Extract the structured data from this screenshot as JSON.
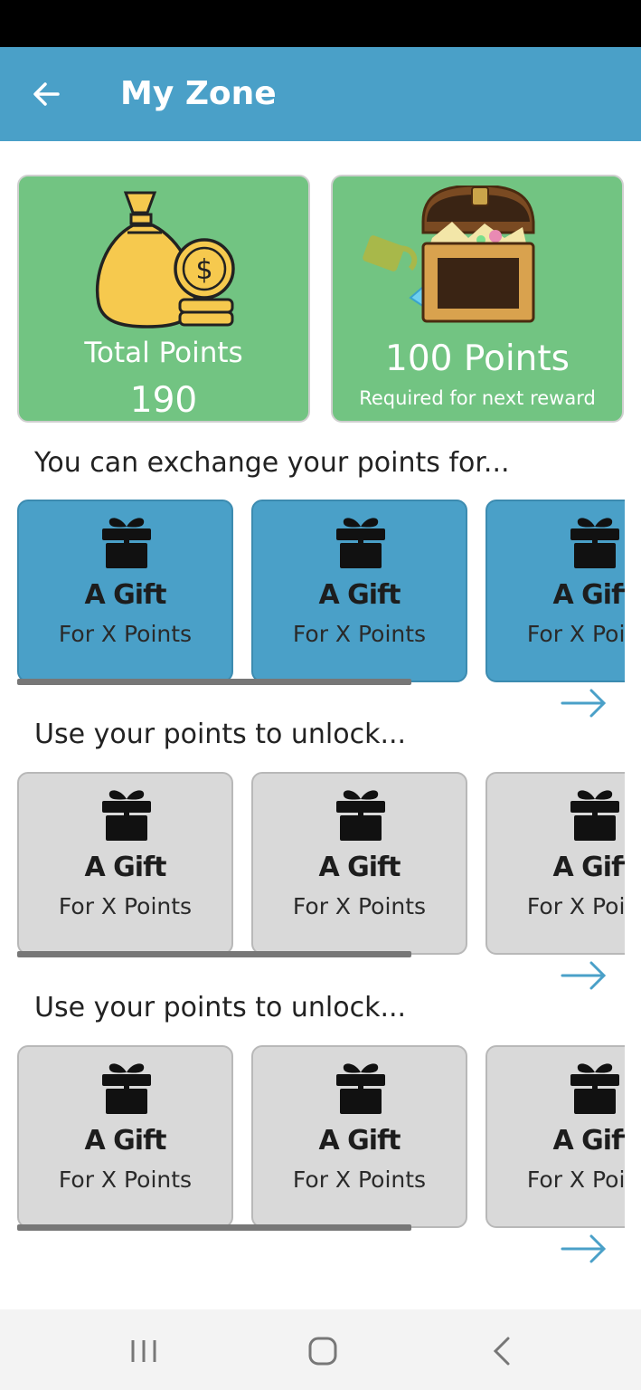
{
  "header": {
    "title": "My Zone",
    "back_icon": "arrow-left-icon"
  },
  "stats": {
    "total": {
      "label": "Total Points",
      "value": "190",
      "icon": "money-bag-icon"
    },
    "next": {
      "value": "100 Points",
      "caption": "Required for next reward",
      "icon": "treasure-chest-icon"
    }
  },
  "sections": [
    {
      "title": "You can exchange your points for...",
      "style": "blue",
      "cards": [
        {
          "title": "A Gift",
          "subtitle": "For X Points"
        },
        {
          "title": "A Gift",
          "subtitle": "For X Points"
        },
        {
          "title": "A Gift",
          "subtitle": "For X Points"
        }
      ]
    },
    {
      "title": "Use your points to unlock...",
      "style": "gray",
      "cards": [
        {
          "title": "A Gift",
          "subtitle": "For X Points"
        },
        {
          "title": "A Gift",
          "subtitle": "For X Points"
        },
        {
          "title": "A Gift",
          "subtitle": "For X Points"
        }
      ]
    },
    {
      "title": "Use your points to unlock...",
      "style": "gray",
      "cards": [
        {
          "title": "A Gift",
          "subtitle": "For X Points"
        },
        {
          "title": "A Gift",
          "subtitle": "For X Points"
        },
        {
          "title": "A Gift",
          "subtitle": "For X Points"
        }
      ]
    }
  ],
  "colors": {
    "app_bar": "#4aa0c8",
    "stat_card": "#72c482",
    "card_blue": "#4aa0c8",
    "card_gray": "#d9d9d9",
    "arrow": "#4aa0c8"
  },
  "nav": {
    "recents_icon": "recents-icon",
    "home_icon": "home-icon",
    "back_icon": "nav-back-icon"
  }
}
